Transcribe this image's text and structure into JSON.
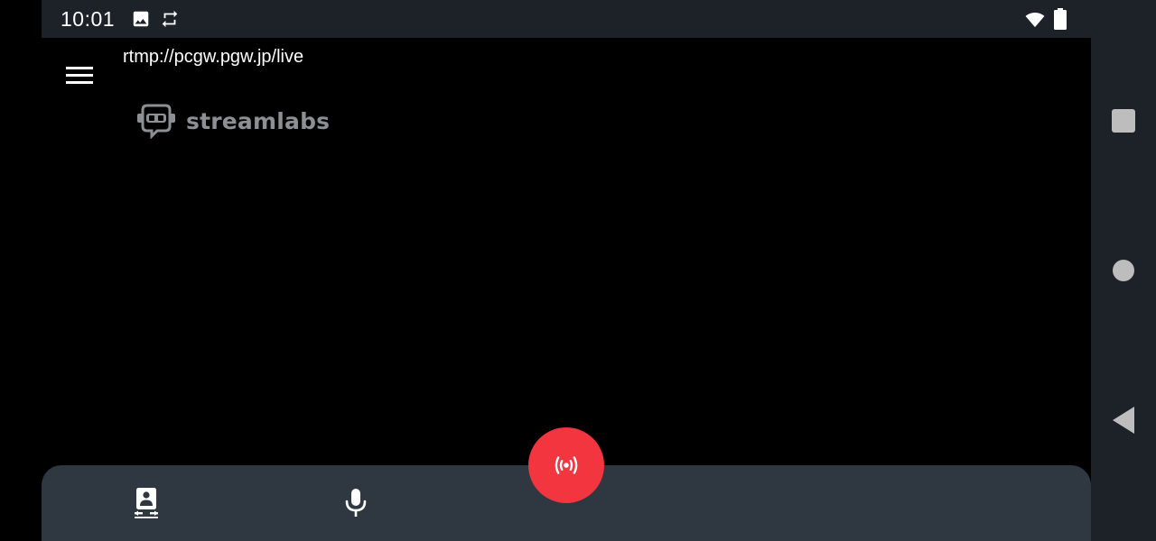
{
  "status_bar": {
    "time": "10:01",
    "icons": [
      "image-icon",
      "sync-icon",
      "wifi-icon",
      "battery-icon"
    ]
  },
  "navigation_bar": {
    "buttons": [
      "recents-button",
      "home-button",
      "back-button"
    ]
  },
  "header": {
    "rtmp_url": "rtmp://pcgw.pgw.jp/live",
    "menu_icon": "hamburger-menu-icon"
  },
  "logo": {
    "text": "streamlabs"
  },
  "bottom_panel": {
    "camera_switch_icon": "switch-camera-icon",
    "mic_icon": "microphone-icon",
    "go_live_icon": "broadcast-icon"
  },
  "colors": {
    "background": "#000000",
    "system_bars": "#1c2228",
    "panel": "#2f3740",
    "go_live": "#f2353e",
    "logo_grey": "#8c8f93",
    "nav_icon_grey": "#bdbdbd"
  }
}
